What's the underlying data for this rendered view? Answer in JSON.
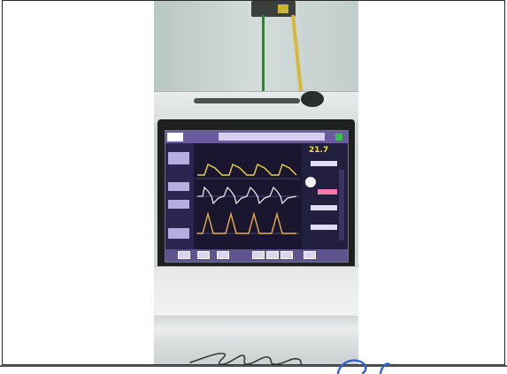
{
  "image": {
    "subject": "ventilator-monitor-photo",
    "colors": {
      "screen_bg": "#1a1630",
      "topbar": "#6a5b9e",
      "wave_yellow": "#e8d24a",
      "wave_white": "#e6e6f0",
      "value_yellow": "#f2e24a",
      "value_pink": "#ff7aa8",
      "status_green": "#35c24a",
      "signature_blue": "#2f5fd6"
    },
    "screen": {
      "readout_primary": "21.7"
    }
  }
}
